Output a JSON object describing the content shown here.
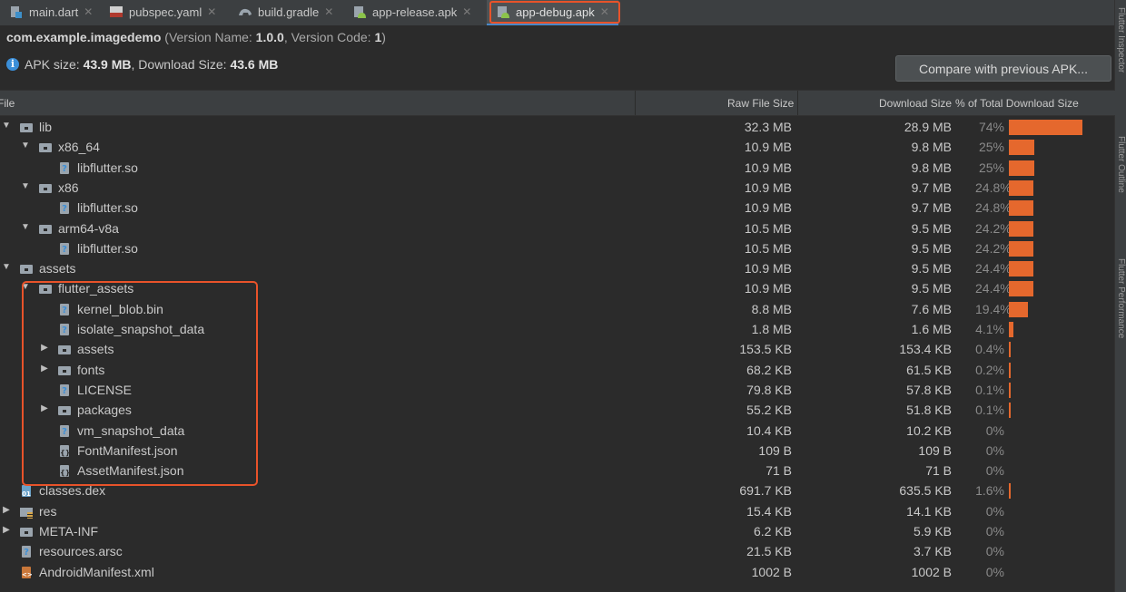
{
  "tabs": [
    {
      "label": "main.dart",
      "icon": "dart-file-icon",
      "active": false
    },
    {
      "label": "pubspec.yaml",
      "icon": "yaml-file-icon",
      "active": false
    },
    {
      "label": "build.gradle",
      "icon": "gradle-file-icon",
      "active": false
    },
    {
      "label": "app-release.apk",
      "icon": "apk-file-icon",
      "active": false
    },
    {
      "label": "app-debug.apk",
      "icon": "apk-file-icon",
      "active": true
    }
  ],
  "side_panel": {
    "labels": [
      "Flutter Inspector",
      "Flutter Outline",
      "Flutter Performance"
    ]
  },
  "package": {
    "name": "com.example.imagedemo",
    "version_prefix": " (Version Name: ",
    "version_name": "1.0.0",
    "version_code_prefix": ", Version Code: ",
    "version_code": "1",
    "version_suffix": ")"
  },
  "apk_size": {
    "label": "APK size: ",
    "value": "43.9 MB",
    "download_label": ", Download Size: ",
    "download_value": "43.6 MB"
  },
  "compare_button": "Compare with previous APK...",
  "columns": {
    "file": "File",
    "raw": "Raw File Size",
    "download": "Download Size",
    "percent": "% of Total Download Size"
  },
  "colors": {
    "bar": "#e5682d",
    "highlight": "#e8532a",
    "tab_accent": "#4a88c7"
  },
  "rows": [
    {
      "name": "lib",
      "depth": 0,
      "expand": "open",
      "icon": "folder-icon",
      "raw": "32.3 MB",
      "download": "28.9 MB",
      "percent": "74%",
      "share": 0.74
    },
    {
      "name": "x86_64",
      "depth": 1,
      "expand": "open",
      "icon": "folder-icon",
      "raw": "10.9 MB",
      "download": "9.8 MB",
      "percent": "25%",
      "share": 0.25
    },
    {
      "name": "libflutter.so",
      "depth": 2,
      "expand": "none",
      "icon": "file-icon",
      "raw": "10.9 MB",
      "download": "9.8 MB",
      "percent": "25%",
      "share": 0.25
    },
    {
      "name": "x86",
      "depth": 1,
      "expand": "open",
      "icon": "folder-icon",
      "raw": "10.9 MB",
      "download": "9.7 MB",
      "percent": "24.8%",
      "share": 0.248
    },
    {
      "name": "libflutter.so",
      "depth": 2,
      "expand": "none",
      "icon": "file-icon",
      "raw": "10.9 MB",
      "download": "9.7 MB",
      "percent": "24.8%",
      "share": 0.248
    },
    {
      "name": "arm64-v8a",
      "depth": 1,
      "expand": "open",
      "icon": "folder-icon",
      "raw": "10.5 MB",
      "download": "9.5 MB",
      "percent": "24.2%",
      "share": 0.242
    },
    {
      "name": "libflutter.so",
      "depth": 2,
      "expand": "none",
      "icon": "file-icon",
      "raw": "10.5 MB",
      "download": "9.5 MB",
      "percent": "24.2%",
      "share": 0.242
    },
    {
      "name": "assets",
      "depth": 0,
      "expand": "open",
      "icon": "folder-icon",
      "raw": "10.9 MB",
      "download": "9.5 MB",
      "percent": "24.4%",
      "share": 0.244
    },
    {
      "name": "flutter_assets",
      "depth": 1,
      "expand": "open",
      "icon": "folder-icon",
      "raw": "10.9 MB",
      "download": "9.5 MB",
      "percent": "24.4%",
      "share": 0.244
    },
    {
      "name": "kernel_blob.bin",
      "depth": 2,
      "expand": "none",
      "icon": "file-icon",
      "raw": "8.8 MB",
      "download": "7.6 MB",
      "percent": "19.4%",
      "share": 0.194
    },
    {
      "name": "isolate_snapshot_data",
      "depth": 2,
      "expand": "none",
      "icon": "file-icon",
      "raw": "1.8 MB",
      "download": "1.6 MB",
      "percent": "4.1%",
      "share": 0.041
    },
    {
      "name": "assets",
      "depth": 2,
      "expand": "closed",
      "icon": "folder-icon",
      "raw": "153.5 KB",
      "download": "153.4 KB",
      "percent": "0.4%",
      "share": 0.004
    },
    {
      "name": "fonts",
      "depth": 2,
      "expand": "closed",
      "icon": "folder-icon",
      "raw": "68.2 KB",
      "download": "61.5 KB",
      "percent": "0.2%",
      "share": 0.002
    },
    {
      "name": "LICENSE",
      "depth": 2,
      "expand": "none",
      "icon": "file-icon",
      "raw": "79.8 KB",
      "download": "57.8 KB",
      "percent": "0.1%",
      "share": 0.001
    },
    {
      "name": "packages",
      "depth": 2,
      "expand": "closed",
      "icon": "folder-icon",
      "raw": "55.2 KB",
      "download": "51.8 KB",
      "percent": "0.1%",
      "share": 0.001
    },
    {
      "name": "vm_snapshot_data",
      "depth": 2,
      "expand": "none",
      "icon": "file-icon",
      "raw": "10.4 KB",
      "download": "10.2 KB",
      "percent": "0%",
      "share": 0
    },
    {
      "name": "FontManifest.json",
      "depth": 2,
      "expand": "none",
      "icon": "json-file-icon",
      "raw": "109 B",
      "download": "109 B",
      "percent": "0%",
      "share": 0
    },
    {
      "name": "AssetManifest.json",
      "depth": 2,
      "expand": "none",
      "icon": "json-file-icon",
      "raw": "71 B",
      "download": "71 B",
      "percent": "0%",
      "share": 0
    },
    {
      "name": "classes.dex",
      "depth": 0,
      "expand": "none",
      "icon": "dex-file-icon",
      "raw": "691.7 KB",
      "download": "635.5 KB",
      "percent": "1.6%",
      "share": 0.016
    },
    {
      "name": "res",
      "depth": 0,
      "expand": "closed",
      "icon": "res-folder-icon",
      "raw": "15.4 KB",
      "download": "14.1 KB",
      "percent": "0%",
      "share": 0
    },
    {
      "name": "META-INF",
      "depth": 0,
      "expand": "closed",
      "icon": "folder-icon",
      "raw": "6.2 KB",
      "download": "5.9 KB",
      "percent": "0%",
      "share": 0
    },
    {
      "name": "resources.arsc",
      "depth": 0,
      "expand": "none",
      "icon": "file-icon",
      "raw": "21.5 KB",
      "download": "3.7 KB",
      "percent": "0%",
      "share": 0
    },
    {
      "name": "AndroidManifest.xml",
      "depth": 0,
      "expand": "none",
      "icon": "xml-file-icon",
      "raw": "1002 B",
      "download": "1002 B",
      "percent": "0%",
      "share": 0
    }
  ]
}
